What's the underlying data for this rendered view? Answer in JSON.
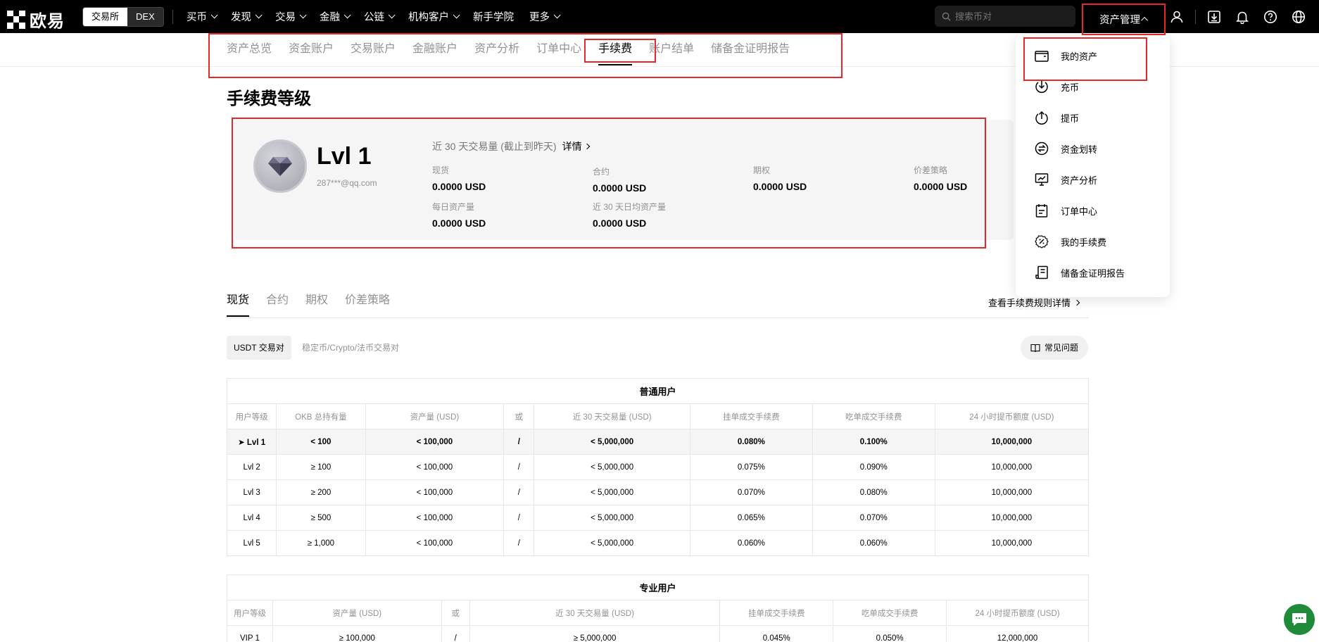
{
  "brand": {
    "name": "欧易"
  },
  "switcher": {
    "exchange": "交易所",
    "dex": "DEX"
  },
  "mainnav": [
    "买币",
    "发现",
    "交易",
    "金融",
    "公链",
    "机构客户",
    "新手学院",
    "更多"
  ],
  "search": {
    "placeholder": "搜索币对"
  },
  "asset_menu": {
    "label": "资产管理"
  },
  "subnav": [
    "资产总览",
    "资金账户",
    "交易账户",
    "金融账户",
    "资产分析",
    "订单中心",
    "手续费",
    "账户结单",
    "储备金证明报告"
  ],
  "page": {
    "title": "手续费等级"
  },
  "level_card": {
    "level": "Lvl 1",
    "email": "287***@qq.com",
    "volume_head": "近 30 天交易量 (截止到昨天)",
    "details": "详情",
    "stats": [
      {
        "label": "现货",
        "value": "0.0000 USD"
      },
      {
        "label": "合约",
        "value": "0.0000 USD"
      },
      {
        "label": "期权",
        "value": "0.0000 USD"
      },
      {
        "label": "价差策略",
        "value": "0.0000 USD"
      },
      {
        "label": "每日资产量",
        "value": "0.0000 USD"
      },
      {
        "label": "近 30 天日均资产量",
        "value": "0.0000 USD"
      }
    ]
  },
  "product_tabs": [
    "现货",
    "合约",
    "期权",
    "价差策略"
  ],
  "rules_link": "查看手续费规则详情",
  "pair_tabs": {
    "active": "USDT 交易对",
    "other": "稳定币/Crypto/法币交易对"
  },
  "faq": "常见问题",
  "regular_table": {
    "caption": "普通用户",
    "headers": [
      "用户等级",
      "OKB 总持有量",
      "资产量 (USD)",
      "或",
      "近 30 天交易量 (USD)",
      "挂单成交手续费",
      "吃单成交手续费",
      "24 小时提币额度 (USD)"
    ],
    "rows": [
      [
        "➤ Lvl 1",
        "< 100",
        "< 100,000",
        "/",
        "< 5,000,000",
        "0.080%",
        "0.100%",
        "10,000,000"
      ],
      [
        "Lvl 2",
        "≥ 100",
        "< 100,000",
        "/",
        "< 5,000,000",
        "0.075%",
        "0.090%",
        "10,000,000"
      ],
      [
        "Lvl 3",
        "≥ 200",
        "< 100,000",
        "/",
        "< 5,000,000",
        "0.070%",
        "0.080%",
        "10,000,000"
      ],
      [
        "Lvl 4",
        "≥ 500",
        "< 100,000",
        "/",
        "< 5,000,000",
        "0.065%",
        "0.070%",
        "10,000,000"
      ],
      [
        "Lvl 5",
        "≥ 1,000",
        "< 100,000",
        "/",
        "< 5,000,000",
        "0.060%",
        "0.060%",
        "10,000,000"
      ]
    ]
  },
  "pro_table": {
    "caption": "专业用户",
    "headers": [
      "用户等级",
      "资产量 (USD)",
      "或",
      "近 30 天交易量 (USD)",
      "挂单成交手续费",
      "吃单成交手续费",
      "24 小时提币额度 (USD)"
    ],
    "rows": [
      [
        "VIP 1",
        "≥ 100,000",
        "/",
        "≥ 5,000,000",
        "0.045%",
        "0.050%",
        "12,000,000"
      ]
    ]
  },
  "dropdown": [
    "我的资产",
    "充币",
    "提币",
    "资金划转",
    "资产分析",
    "订单中心",
    "我的手续费",
    "储备金证明报告"
  ],
  "colors": {
    "highlight_box": "#e5262b",
    "chat": "#1f8a3a"
  }
}
